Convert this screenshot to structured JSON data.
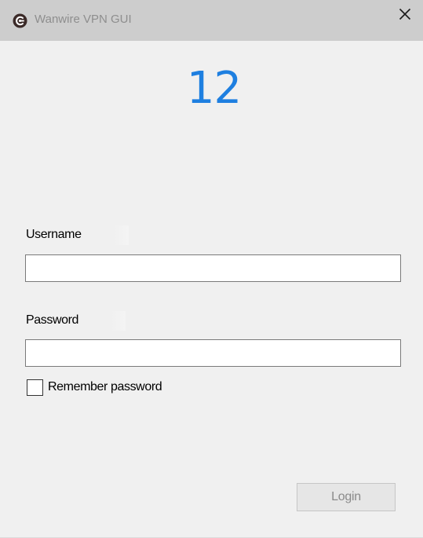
{
  "window": {
    "title": "Wanwire VPN GUI",
    "app_icon": "wanwire-logo-icon",
    "close_icon": "close-icon"
  },
  "brand": {
    "logo_text": "12",
    "color": "#1e7fe0"
  },
  "form": {
    "username_label": "Username",
    "username_value": "",
    "password_label": "Password",
    "password_value": "",
    "remember_label": "Remember password",
    "remember_checked": false,
    "login_label": "Login",
    "login_enabled": false
  }
}
